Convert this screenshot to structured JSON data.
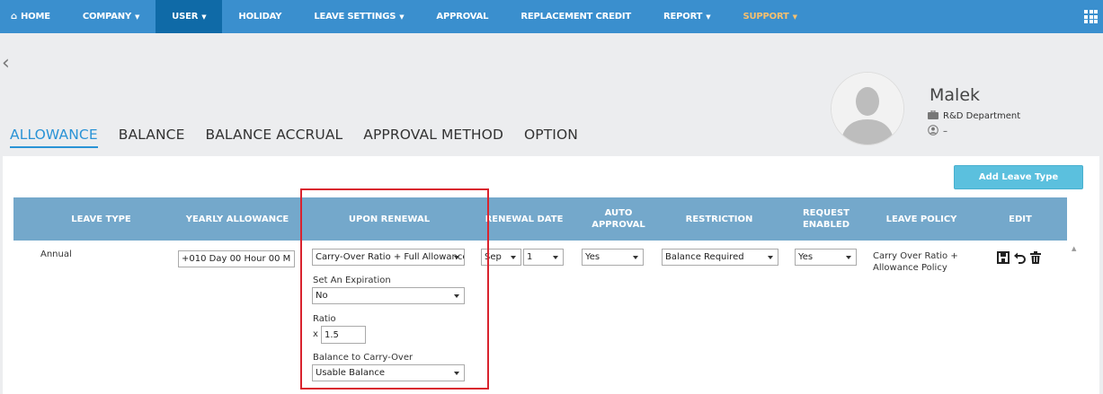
{
  "nav": {
    "home": "HOME",
    "company": "COMPANY",
    "user": "USER",
    "holiday": "HOLIDAY",
    "leave_settings": "LEAVE SETTINGS",
    "approval": "APPROVAL",
    "replacement_credit": "REPLACEMENT CREDIT",
    "report": "REPORT",
    "support": "SUPPORT"
  },
  "tabs": {
    "allowance": "ALLOWANCE",
    "balance": "BALANCE",
    "balance_accrual": "BALANCE ACCRUAL",
    "approval_method": "APPROVAL METHOD",
    "option": "OPTION"
  },
  "profile": {
    "name": "Malek",
    "department": "R&D Department",
    "extra": "–"
  },
  "add_button": "Add Leave Type",
  "table": {
    "headers": {
      "leave_type": "LEAVE TYPE",
      "yearly_allowance": "YEARLY ALLOWANCE",
      "upon_renewal": "UPON RENEWAL",
      "renewal_date": "RENEWAL DATE",
      "auto_approval": "AUTO APPROVAL",
      "restriction": "RESTRICTION",
      "request_enabled": "REQUEST ENABLED",
      "leave_policy": "LEAVE POLICY",
      "edit": "EDIT"
    },
    "row": {
      "leave_type": "Annual",
      "yearly_allowance": "+010 Day 00 Hour 00 M",
      "upon_renewal": "Carry-Over Ratio + Full Allowance",
      "expiration_label": "Set An Expiration",
      "expiration": "No",
      "ratio_label": "Ratio",
      "ratio_prefix": "x",
      "ratio": "1.5",
      "carry_label": "Balance to Carry-Over",
      "carry": "Usable Balance",
      "renewal_month": "Sep",
      "renewal_day": "1",
      "auto_approval": "Yes",
      "restriction": "Balance Required",
      "request_enabled": "Yes",
      "leave_policy": "Carry Over Ratio + Allowance Policy"
    }
  }
}
